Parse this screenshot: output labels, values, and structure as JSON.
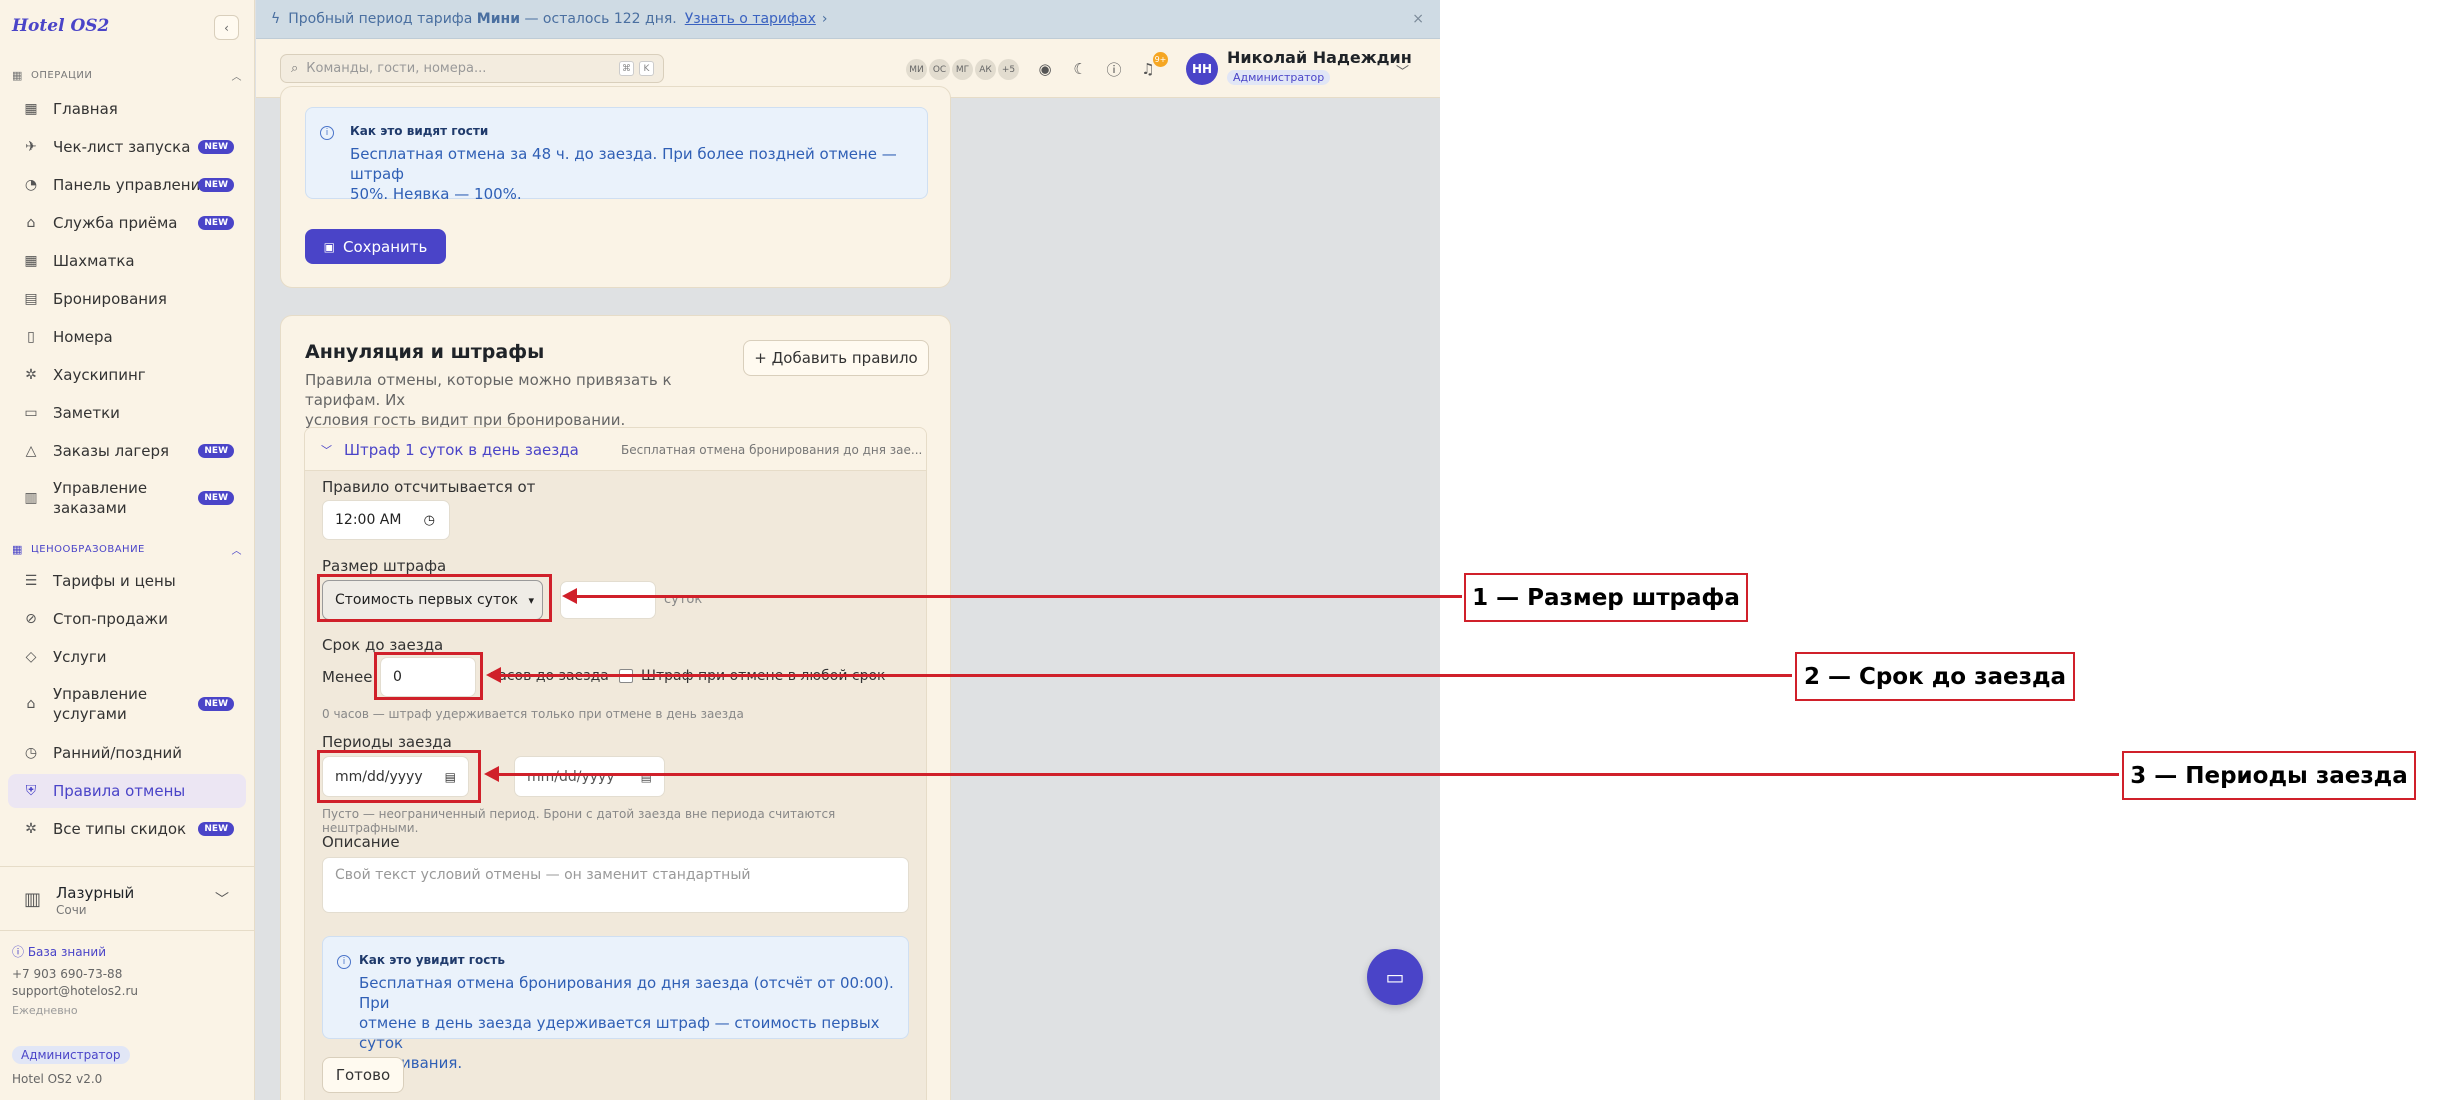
{
  "app": {
    "name": "Hotel OS2",
    "version": "Hotel OS2 v2.0"
  },
  "sidebar": {
    "sections": [
      {
        "label": "ОПЕРАЦИИ",
        "icon": "grid-icon",
        "color": "#777777"
      },
      {
        "label": "ЦЕНООБРАЗОВАНИЕ",
        "icon": "tag-icon",
        "color": "#4a44c8"
      }
    ],
    "items": [
      {
        "label": "Главная",
        "icon": "dashboard-icon",
        "badge": ""
      },
      {
        "label": "Чек-лист запуска",
        "icon": "rocket-icon",
        "badge": "NEW"
      },
      {
        "label": "Панель управления",
        "icon": "gauge-icon",
        "badge": "NEW"
      },
      {
        "label": "Служба приёма",
        "icon": "bell-desk-icon",
        "badge": "NEW"
      },
      {
        "label": "Шахматка",
        "icon": "grid-icon",
        "badge": ""
      },
      {
        "label": "Бронирования",
        "icon": "calendar-icon",
        "badge": ""
      },
      {
        "label": "Номера",
        "icon": "door-icon",
        "badge": ""
      },
      {
        "label": "Хаускипинг",
        "icon": "sparkle-icon",
        "badge": ""
      },
      {
        "label": "Заметки",
        "icon": "note-icon",
        "badge": ""
      },
      {
        "label": "Заказы лагеря",
        "icon": "tent-icon",
        "badge": "NEW"
      },
      {
        "label": "Управление заказами",
        "icon": "receipt-icon",
        "badge": "NEW"
      },
      {
        "label": "Тарифы и цены",
        "icon": "list-icon",
        "badge": ""
      },
      {
        "label": "Стоп-продажи",
        "icon": "ban-icon",
        "badge": ""
      },
      {
        "label": "Услуги",
        "icon": "tag-icon",
        "badge": ""
      },
      {
        "label": "Управление услугами",
        "icon": "bell-desk-icon",
        "badge": "NEW"
      },
      {
        "label": "Ранний/поздний",
        "icon": "alarm-icon",
        "badge": ""
      },
      {
        "label": "Правила отмены",
        "icon": "shield-icon",
        "badge": ""
      },
      {
        "label": "Все типы скидок",
        "icon": "sparkle-icon",
        "badge": "NEW"
      }
    ],
    "hotel": {
      "name": "Лазурный",
      "city": "Сочи"
    },
    "footer": {
      "kb": "База знаний",
      "phone": "+7 903 690-73-88",
      "email": "support@hotelos2.ru",
      "hours": "Ежедневно",
      "role": "Администратор"
    }
  },
  "banner": {
    "text_before": "Пробный период тарифа",
    "plan": "Мини",
    "text_after": "— осталось 122 дня.",
    "link": "Узнать о тарифах",
    "close": "×"
  },
  "topbar": {
    "search_placeholder": "Команды, гости, номера...",
    "shortcut": [
      "⌘",
      "K"
    ],
    "avatars": [
      "МИ",
      "ОС",
      "МГ",
      "АК",
      "+5"
    ],
    "notifications_count": "9+",
    "user": {
      "initials": "НН",
      "name": "Николай Надеждин",
      "role": "Администратор"
    }
  },
  "top_card": {
    "info_title": "Как это видят гости",
    "info_text_1": "Бесплатная отмена за 48 ч. до заезда. При более поздней отмене — штраф",
    "info_text_2": "50%. Неявка — 100%.",
    "save_button": "Сохранить"
  },
  "cancel_card": {
    "title": "Аннуляция и штрафы",
    "subtitle_1": "Правила отмены, которые можно привязать к тарифам. Их",
    "subtitle_2": "условия гость видит при бронировании.",
    "add_button": "+ Добавить правило",
    "rule": {
      "title": "Штраф 1 суток в день заезда",
      "summary": "Бесплатная отмена бронирования до дня зае...",
      "start_label": "Правило отсчитывается от",
      "start_time": "12:00 AM",
      "size_label": "Размер штрафа",
      "size_value": "Стоимость первых суток",
      "size_unit": "суток",
      "deadline_label": "Срок до заезда",
      "deadline_prefix": "Менее",
      "deadline_value": "0",
      "deadline_suffix": "часов до заезда",
      "any_time_checkbox": "Штраф при отмене в любой срок",
      "deadline_hint": "0 часов — штраф удерживается только при отмене в день заезда",
      "periods_label": "Периоды заезда",
      "date_placeholder": "mm/dd/yyyy",
      "periods_hint": "Пусто — неограниченный период. Брони с датой заезда вне периода считаются нештрафными.",
      "desc_label": "Описание",
      "desc_placeholder": "Свой текст условий отмены — он заменит стандартный",
      "guest_info_title": "Как это увидит гость",
      "guest_info_1": "Бесплатная отмена бронирования до дня заезда (отсчёт от 00:00). При",
      "guest_info_2": "отмене в день заезда удерживается штраф — стоимость первых суток",
      "guest_info_3": "проживания.",
      "done_button": "Готово"
    }
  },
  "annotations": [
    {
      "label": "1 — Размер штрафа"
    },
    {
      "label": "2 — Срок до заезда"
    },
    {
      "label": "3 — Периоды заезда"
    }
  ],
  "colors": {
    "accent": "#4a44c8",
    "annotation": "#d0202a",
    "sidebar_bg": "#faf3e6",
    "info_bg": "#eaf2fb"
  }
}
